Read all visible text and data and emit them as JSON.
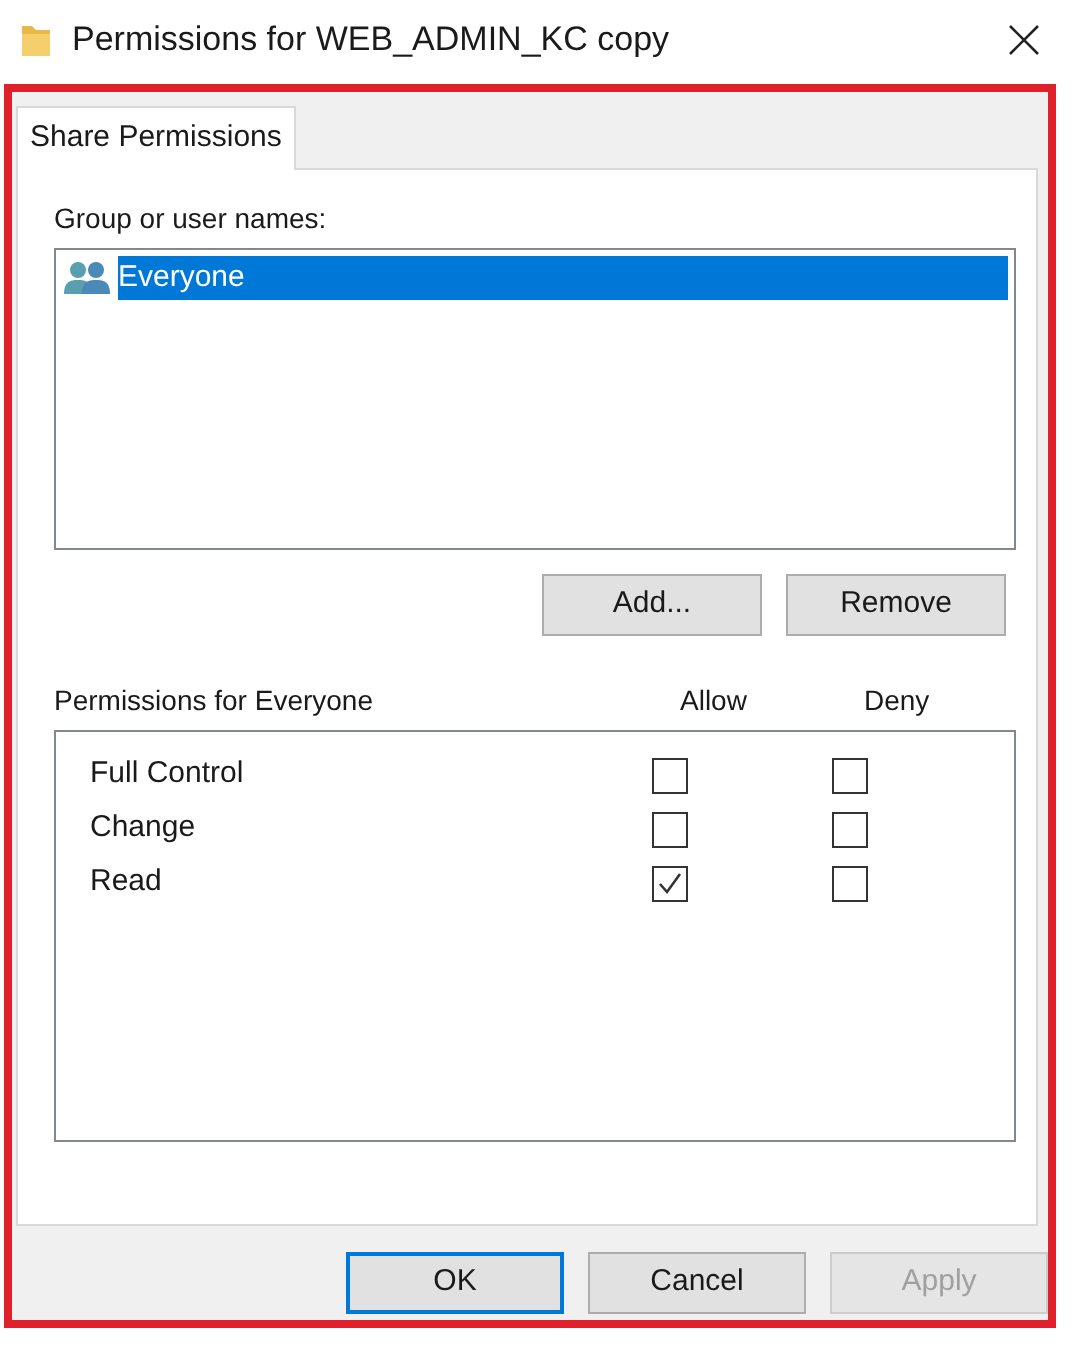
{
  "window": {
    "title": "Permissions for WEB_ADMIN_KC copy"
  },
  "tabs": [
    {
      "label": "Share Permissions",
      "selected": true
    }
  ],
  "group_label": "Group or user names:",
  "users": [
    {
      "name": "Everyone",
      "selected": true
    }
  ],
  "user_buttons": [
    {
      "label": "Add...",
      "disabled": false
    },
    {
      "label": "Remove",
      "disabled": false
    }
  ],
  "permissions": {
    "title": "Permissions for Everyone",
    "columns": [
      "Allow",
      "Deny"
    ],
    "rows": [
      {
        "name": "Full Control",
        "allow": false,
        "deny": false
      },
      {
        "name": "Change",
        "allow": false,
        "deny": false
      },
      {
        "name": "Read",
        "allow": true,
        "deny": false
      }
    ]
  },
  "buttons": [
    {
      "label": "OK",
      "default": true,
      "disabled": false
    },
    {
      "label": "Cancel",
      "default": false,
      "disabled": false
    },
    {
      "label": "Apply",
      "default": false,
      "disabled": true
    }
  ]
}
